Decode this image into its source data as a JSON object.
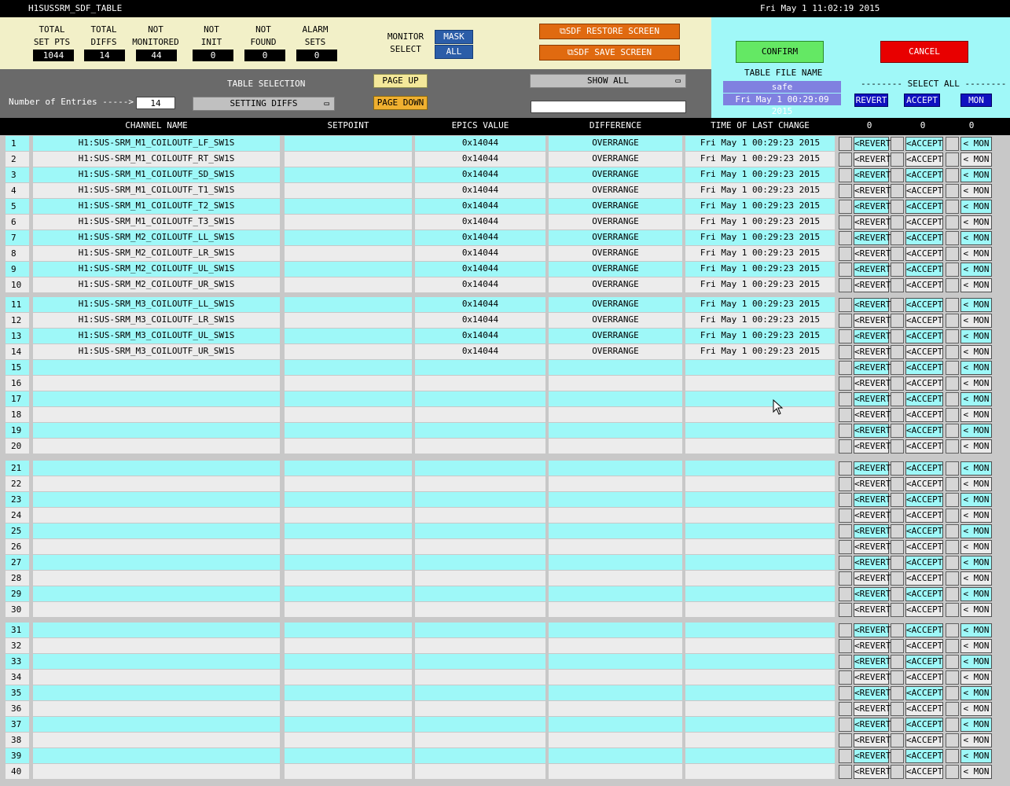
{
  "window": {
    "title": "H1SUSSRM_SDF_TABLE",
    "datetime": "Fri May  1 11:02:19 2015"
  },
  "stats": [
    {
      "label1": "TOTAL",
      "label2": "SET PTS",
      "value": "1044"
    },
    {
      "label1": "TOTAL",
      "label2": "DIFFS",
      "value": "14"
    },
    {
      "label1": "NOT",
      "label2": "MONITORED",
      "value": "44"
    },
    {
      "label1": "NOT",
      "label2": "INIT",
      "value": "0"
    },
    {
      "label1": "NOT",
      "label2": "FOUND",
      "value": "0"
    },
    {
      "label1": "ALARM",
      "label2": "SETS",
      "value": "0"
    }
  ],
  "monitor_select": {
    "label1": "MONITOR",
    "label2": "SELECT",
    "mask": "MASK",
    "all": "ALL"
  },
  "sdf": {
    "restore": "SDF RESTORE SCREEN",
    "save": "SDF SAVE SCREEN"
  },
  "controls": {
    "entries_label": "Number of Entries ----->",
    "entries_value": "14",
    "table_selection_label": "TABLE SELECTION",
    "table_selection_value": "SETTING DIFFS",
    "page_up": "PAGE UP",
    "page_down": "PAGE DOWN",
    "show_all": "SHOW ALL",
    "filter_value": ""
  },
  "file_panel": {
    "confirm": "CONFIRM",
    "cancel": "CANCEL",
    "table_file_name_label": "TABLE FILE NAME",
    "file_name": "safe",
    "file_date": "Fri May  1 00:29:09 2015",
    "select_all": "-------- SELECT ALL --------",
    "revert": "REVERT",
    "accept": "ACCEPT",
    "mon": "MON"
  },
  "columns": {
    "channel": "CHANNEL NAME",
    "setpoint": "SETPOINT",
    "epics": "EPICS VALUE",
    "difference": "DIFFERENCE",
    "time": "TIME OF LAST CHANGE",
    "count_revert": "0",
    "count_accept": "0",
    "count_mon": "0"
  },
  "row_buttons": {
    "revert": "<REVERT",
    "accept": "<ACCEPT",
    "mon": "< MON"
  },
  "colors": {
    "cyan": "#9ef8f8",
    "gray": "#ececec"
  },
  "rows": [
    {
      "n": "1",
      "channel": "H1:SUS-SRM_M1_COILOUTF_LF_SW1S",
      "setpoint": "",
      "epics": "0x14044",
      "diff": "OVERRANGE",
      "time": "Fri May  1 00:29:23 2015"
    },
    {
      "n": "2",
      "channel": "H1:SUS-SRM_M1_COILOUTF_RT_SW1S",
      "setpoint": "",
      "epics": "0x14044",
      "diff": "OVERRANGE",
      "time": "Fri May  1 00:29:23 2015"
    },
    {
      "n": "3",
      "channel": "H1:SUS-SRM_M1_COILOUTF_SD_SW1S",
      "setpoint": "",
      "epics": "0x14044",
      "diff": "OVERRANGE",
      "time": "Fri May  1 00:29:23 2015"
    },
    {
      "n": "4",
      "channel": "H1:SUS-SRM_M1_COILOUTF_T1_SW1S",
      "setpoint": "",
      "epics": "0x14044",
      "diff": "OVERRANGE",
      "time": "Fri May  1 00:29:23 2015"
    },
    {
      "n": "5",
      "channel": "H1:SUS-SRM_M1_COILOUTF_T2_SW1S",
      "setpoint": "",
      "epics": "0x14044",
      "diff": "OVERRANGE",
      "time": "Fri May  1 00:29:23 2015"
    },
    {
      "n": "6",
      "channel": "H1:SUS-SRM_M1_COILOUTF_T3_SW1S",
      "setpoint": "",
      "epics": "0x14044",
      "diff": "OVERRANGE",
      "time": "Fri May  1 00:29:23 2015"
    },
    {
      "n": "7",
      "channel": "H1:SUS-SRM_M2_COILOUTF_LL_SW1S",
      "setpoint": "",
      "epics": "0x14044",
      "diff": "OVERRANGE",
      "time": "Fri May  1 00:29:23 2015"
    },
    {
      "n": "8",
      "channel": "H1:SUS-SRM_M2_COILOUTF_LR_SW1S",
      "setpoint": "",
      "epics": "0x14044",
      "diff": "OVERRANGE",
      "time": "Fri May  1 00:29:23 2015"
    },
    {
      "n": "9",
      "channel": "H1:SUS-SRM_M2_COILOUTF_UL_SW1S",
      "setpoint": "",
      "epics": "0x14044",
      "diff": "OVERRANGE",
      "time": "Fri May  1 00:29:23 2015"
    },
    {
      "n": "10",
      "channel": "H1:SUS-SRM_M2_COILOUTF_UR_SW1S",
      "setpoint": "",
      "epics": "0x14044",
      "diff": "OVERRANGE",
      "time": "Fri May  1 00:29:23 2015"
    },
    {
      "n": "11",
      "channel": "H1:SUS-SRM_M3_COILOUTF_LL_SW1S",
      "setpoint": "",
      "epics": "0x14044",
      "diff": "OVERRANGE",
      "time": "Fri May  1 00:29:23 2015"
    },
    {
      "n": "12",
      "channel": "H1:SUS-SRM_M3_COILOUTF_LR_SW1S",
      "setpoint": "",
      "epics": "0x14044",
      "diff": "OVERRANGE",
      "time": "Fri May  1 00:29:23 2015"
    },
    {
      "n": "13",
      "channel": "H1:SUS-SRM_M3_COILOUTF_UL_SW1S",
      "setpoint": "",
      "epics": "0x14044",
      "diff": "OVERRANGE",
      "time": "Fri May  1 00:29:23 2015"
    },
    {
      "n": "14",
      "channel": "H1:SUS-SRM_M3_COILOUTF_UR_SW1S",
      "setpoint": "",
      "epics": "0x14044",
      "diff": "OVERRANGE",
      "time": "Fri May  1 00:29:23 2015"
    },
    {
      "n": "15",
      "channel": "",
      "setpoint": "",
      "epics": "",
      "diff": "",
      "time": ""
    },
    {
      "n": "16",
      "channel": "",
      "setpoint": "",
      "epics": "",
      "diff": "",
      "time": ""
    },
    {
      "n": "17",
      "channel": "",
      "setpoint": "",
      "epics": "",
      "diff": "",
      "time": ""
    },
    {
      "n": "18",
      "channel": "",
      "setpoint": "",
      "epics": "",
      "diff": "",
      "time": ""
    },
    {
      "n": "19",
      "channel": "",
      "setpoint": "",
      "epics": "",
      "diff": "",
      "time": ""
    },
    {
      "n": "20",
      "channel": "",
      "setpoint": "",
      "epics": "",
      "diff": "",
      "time": ""
    },
    {
      "n": "21",
      "channel": "",
      "setpoint": "",
      "epics": "",
      "diff": "",
      "time": ""
    },
    {
      "n": "22",
      "channel": "",
      "setpoint": "",
      "epics": "",
      "diff": "",
      "time": ""
    },
    {
      "n": "23",
      "channel": "",
      "setpoint": "",
      "epics": "",
      "diff": "",
      "time": ""
    },
    {
      "n": "24",
      "channel": "",
      "setpoint": "",
      "epics": "",
      "diff": "",
      "time": ""
    },
    {
      "n": "25",
      "channel": "",
      "setpoint": "",
      "epics": "",
      "diff": "",
      "time": ""
    },
    {
      "n": "26",
      "channel": "",
      "setpoint": "",
      "epics": "",
      "diff": "",
      "time": ""
    },
    {
      "n": "27",
      "channel": "",
      "setpoint": "",
      "epics": "",
      "diff": "",
      "time": ""
    },
    {
      "n": "28",
      "channel": "",
      "setpoint": "",
      "epics": "",
      "diff": "",
      "time": ""
    },
    {
      "n": "29",
      "channel": "",
      "setpoint": "",
      "epics": "",
      "diff": "",
      "time": ""
    },
    {
      "n": "30",
      "channel": "",
      "setpoint": "",
      "epics": "",
      "diff": "",
      "time": ""
    },
    {
      "n": "31",
      "channel": "",
      "setpoint": "",
      "epics": "",
      "diff": "",
      "time": ""
    },
    {
      "n": "32",
      "channel": "",
      "setpoint": "",
      "epics": "",
      "diff": "",
      "time": ""
    },
    {
      "n": "33",
      "channel": "",
      "setpoint": "",
      "epics": "",
      "diff": "",
      "time": ""
    },
    {
      "n": "34",
      "channel": "",
      "setpoint": "",
      "epics": "",
      "diff": "",
      "time": ""
    },
    {
      "n": "35",
      "channel": "",
      "setpoint": "",
      "epics": "",
      "diff": "",
      "time": ""
    },
    {
      "n": "36",
      "channel": "",
      "setpoint": "",
      "epics": "",
      "diff": "",
      "time": ""
    },
    {
      "n": "37",
      "channel": "",
      "setpoint": "",
      "epics": "",
      "diff": "",
      "time": ""
    },
    {
      "n": "38",
      "channel": "",
      "setpoint": "",
      "epics": "",
      "diff": "",
      "time": ""
    },
    {
      "n": "39",
      "channel": "",
      "setpoint": "",
      "epics": "",
      "diff": "",
      "time": ""
    },
    {
      "n": "40",
      "channel": "",
      "setpoint": "",
      "epics": "",
      "diff": "",
      "time": ""
    }
  ]
}
